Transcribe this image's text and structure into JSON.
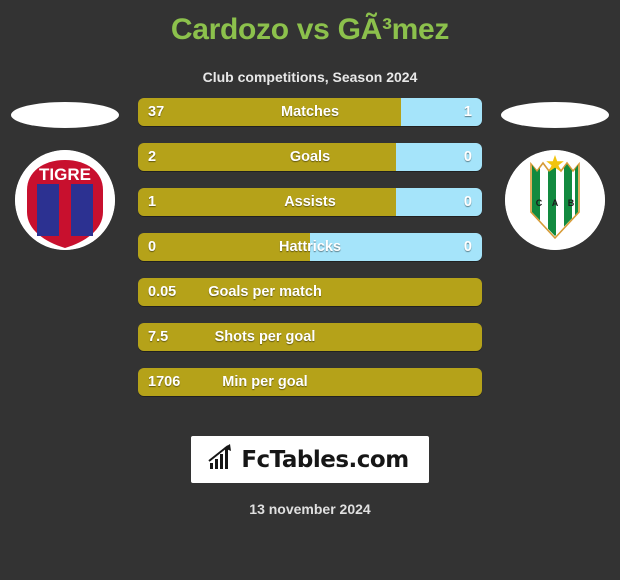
{
  "header": {
    "title": "Cardozo vs GÃ³mez",
    "subtitle": "Club competitions, Season 2024"
  },
  "colors": {
    "background": "#333333",
    "title": "#8cc14c",
    "home_bar": "#b5a219",
    "away_bar": "#a5e4fa",
    "text": "#ffffff"
  },
  "badges": {
    "home": {
      "name": "tigre-crest",
      "text": "TIGRE"
    },
    "away": {
      "name": "banfield-crest",
      "text": "C A B"
    }
  },
  "stats": [
    {
      "label": "Matches",
      "home": "37",
      "away": "1",
      "home_pct": 76.5,
      "away_pct": 23.5,
      "has_away": true
    },
    {
      "label": "Goals",
      "home": "2",
      "away": "0",
      "home_pct": 75.0,
      "away_pct": 25.0,
      "has_away": true
    },
    {
      "label": "Assists",
      "home": "1",
      "away": "0",
      "home_pct": 75.0,
      "away_pct": 25.0,
      "has_away": true
    },
    {
      "label": "Hattricks",
      "home": "0",
      "away": "0",
      "home_pct": 50.0,
      "away_pct": 50.0,
      "has_away": true
    },
    {
      "label": "Goals per match",
      "home": "0.05",
      "away": "",
      "home_pct": 100,
      "away_pct": 0,
      "has_away": false
    },
    {
      "label": "Shots per goal",
      "home": "7.5",
      "away": "",
      "home_pct": 100,
      "away_pct": 0,
      "has_away": false
    },
    {
      "label": "Min per goal",
      "home": "1706",
      "away": "",
      "home_pct": 100,
      "away_pct": 0,
      "has_away": false
    }
  ],
  "footer": {
    "logo_text": "FcTables.com",
    "date": "13 november 2024"
  }
}
